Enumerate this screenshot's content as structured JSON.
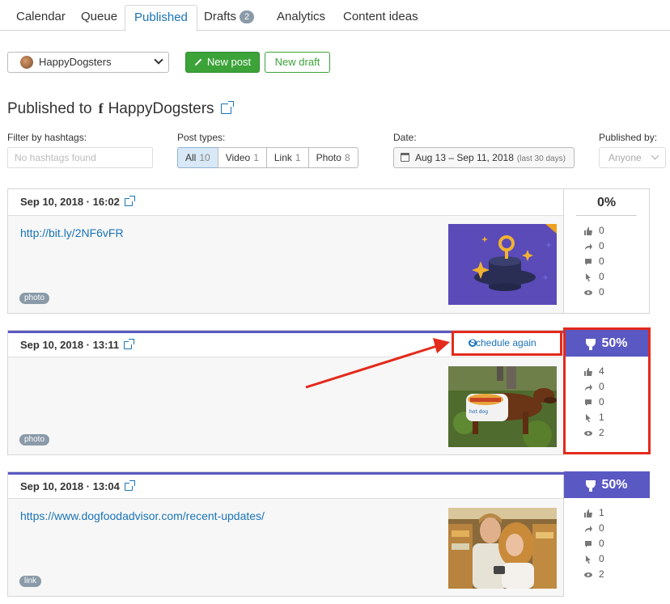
{
  "tabs": [
    {
      "label": "Calendar"
    },
    {
      "label": "Queue"
    },
    {
      "label": "Published"
    },
    {
      "label": "Drafts",
      "badge": "2"
    },
    {
      "label": "Analytics"
    },
    {
      "label": "Content ideas"
    }
  ],
  "account": {
    "name": "HappyDogsters"
  },
  "buttons": {
    "new_post": "New post",
    "new_draft": "New draft"
  },
  "heading": {
    "prefix": "Published to",
    "network_icon": "f",
    "account": "HappyDogsters"
  },
  "filters": {
    "hashtags_label": "Filter by hashtags:",
    "hashtags_placeholder": "No hashtags found",
    "post_types_label": "Post types:",
    "post_types": [
      {
        "label": "All",
        "count": "10",
        "active": true
      },
      {
        "label": "Video",
        "count": "1"
      },
      {
        "label": "Link",
        "count": "1"
      },
      {
        "label": "Photo",
        "count": "8"
      }
    ],
    "date_label": "Date:",
    "date_value": "Aug 13 – Sep 11, 2018",
    "date_hint": "(last 30 days)",
    "published_by_label": "Published by:",
    "published_by_value": "Anyone"
  },
  "posts": [
    {
      "date": "Sep 10, 2018 · 16:02",
      "link": "http://bit.ly/2NF6vFR",
      "tag": "photo",
      "score": "0%",
      "stats": [
        "0",
        "0",
        "0",
        "0",
        "0"
      ]
    },
    {
      "date": "Sep 10, 2018 · 13:11",
      "link": "",
      "tag": "photo",
      "score": "50%",
      "action": "Schedule again",
      "stats": [
        "4",
        "0",
        "0",
        "1",
        "2"
      ]
    },
    {
      "date": "Sep 10, 2018 · 13:04",
      "link": "https://www.dogfoodadvisor.com/recent-updates/",
      "tag": "link",
      "score": "50%",
      "stats": [
        "1",
        "0",
        "0",
        "0",
        "2"
      ]
    }
  ],
  "stat_icons": [
    "like-icon",
    "share-icon",
    "comment-icon",
    "click-icon",
    "view-icon"
  ],
  "colors": {
    "accent": "#1a73b8",
    "green": "#3ca339",
    "winner": "#5a58c3",
    "highlight": "#e32a1c"
  }
}
